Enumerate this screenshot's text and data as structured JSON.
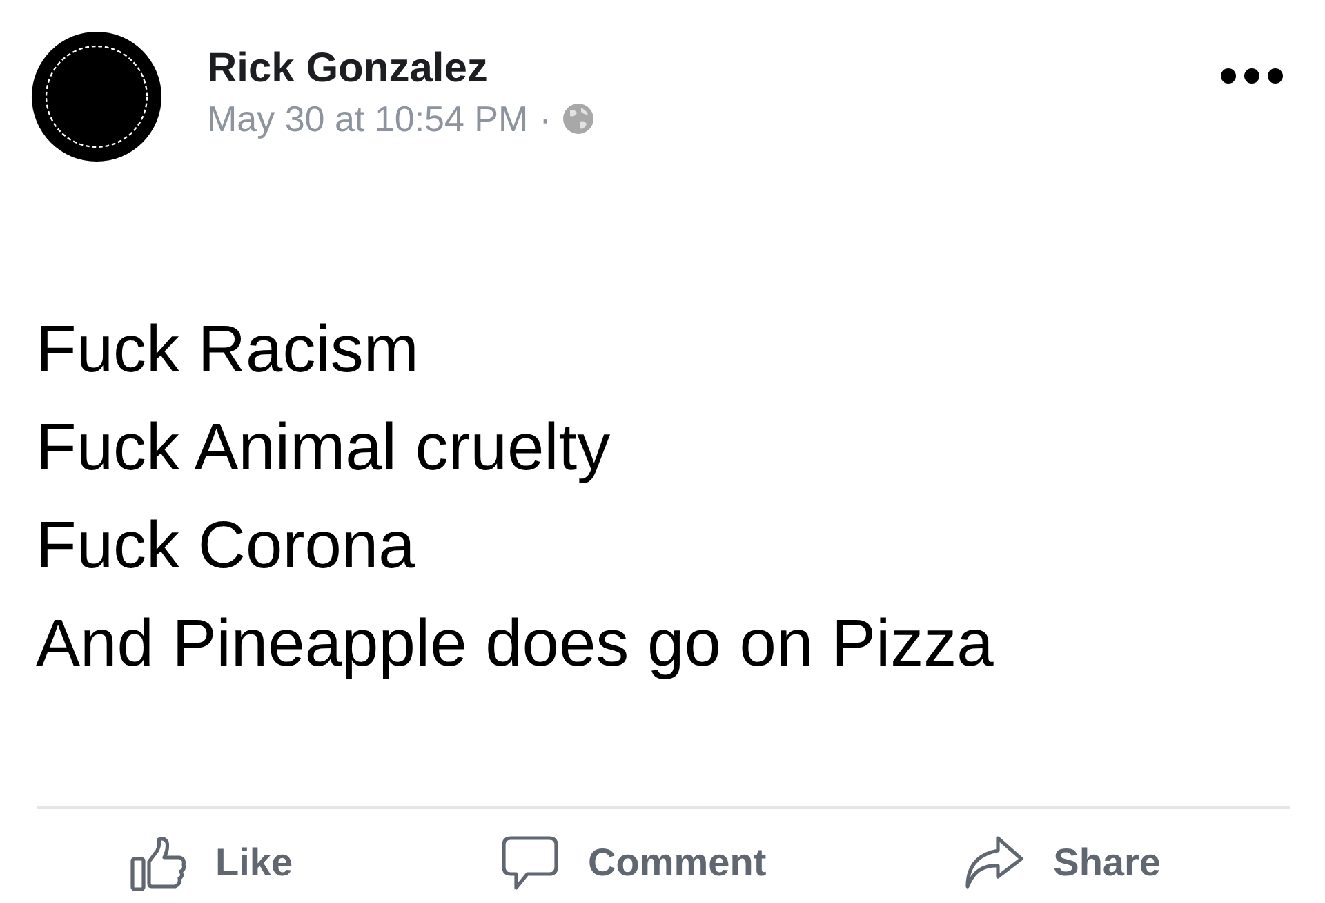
{
  "post": {
    "author": "Rick Gonzalez",
    "timestamp": "May 30 at 10:54 PM",
    "separator": "·",
    "lines": [
      "Fuck Racism",
      "Fuck Animal cruelty",
      "Fuck Corona",
      "And Pineapple does go on Pizza"
    ]
  },
  "actions": [
    {
      "kind": "like",
      "label": "Like"
    },
    {
      "kind": "comment",
      "label": "Comment"
    },
    {
      "kind": "share",
      "label": "Share"
    }
  ]
}
